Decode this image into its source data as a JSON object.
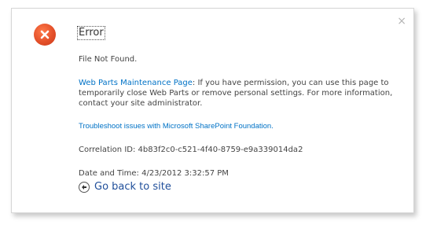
{
  "dialog": {
    "close_glyph": "×",
    "title": "Error",
    "message": "File Not Found.",
    "maintenance": {
      "link_text": "Web Parts Maintenance Page",
      "text": ": If you have permission, you can use this page to temporarily close Web Parts or remove personal settings. For more information, contact your site administrator."
    },
    "troubleshoot_link": "Troubleshoot issues with Microsoft SharePoint Foundation.",
    "correlation_id": "Correlation ID: 4b83f2c0-c521-4f40-8759-e9a339014da2",
    "date_time": "Date and Time: 4/23/2012 3:32:57 PM",
    "go_back": "Go back to site"
  },
  "icons": {
    "error": "error-x-icon",
    "close": "close-icon",
    "back": "back-arrow-icon"
  },
  "colors": {
    "error_icon": "#e4502a",
    "link": "#0072c6",
    "go_back": "#1f4e9a"
  }
}
